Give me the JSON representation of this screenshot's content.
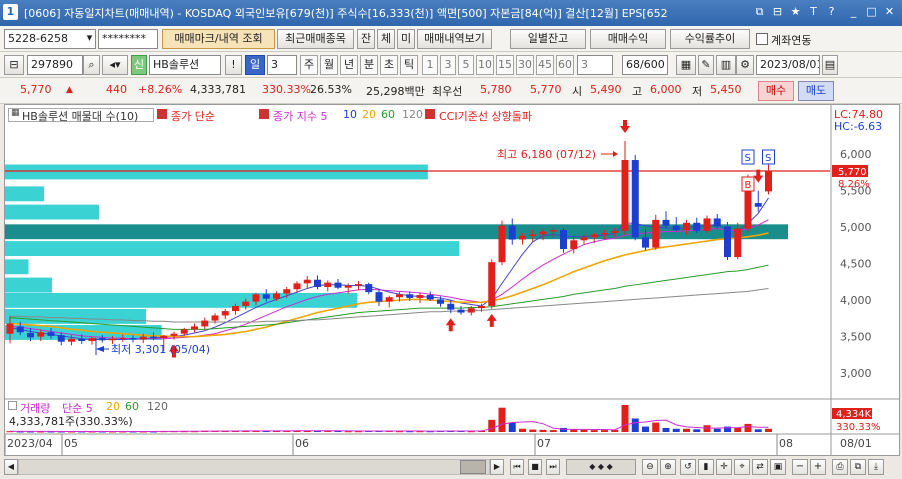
{
  "window": {
    "number": "1",
    "title": "[0606] 자동일지차트(매매내역) - KOSDAQ 외국인보유[679(천)] 주식수[16,333(천)] 액면[500] 자본금[84(억)] 결산[12월] EPS[652",
    "buttons": [
      "⧉",
      "⊟",
      "★",
      "T",
      "?",
      "_",
      "□",
      "✕"
    ]
  },
  "toolbar1": {
    "account": "5228-6258",
    "password": "********",
    "trade_mark_btn": "매매마크/내역 조회",
    "recent_trades_btn": "최근매매종목",
    "tab_balance": "잔",
    "tab_exec": "체",
    "tab_unexec": "미",
    "trade_history_btn": "매매내역보기",
    "daily_balance_btn": "일별잔고",
    "trade_profit_btn": "매매수익",
    "profit_trend_btn": "수익률추이",
    "account_link_label": "계좌연동"
  },
  "toolbar2": {
    "code": "297890",
    "stock_name": "HB솔루션",
    "credit_badge": "신",
    "period_day": "일",
    "period_value": "3",
    "periods": [
      "주",
      "월",
      "년",
      "분",
      "초",
      "틱"
    ],
    "intervals": [
      "1",
      "3",
      "5",
      "10",
      "15",
      "30",
      "45",
      "60"
    ],
    "interval_value": "3",
    "page_count": "68/600",
    "date": "2023/08/01"
  },
  "pricebar": {
    "price": "5,770",
    "change": "440",
    "change_pct": "+8.26%",
    "volume": "4,333,781",
    "volume_ratio": "330.33%",
    "turnover": "26.53%",
    "amount": "25,298백만",
    "priority_sell_label": "최우선",
    "priority_sell": "5,780",
    "priority_buy": "5,770",
    "open_label": "시",
    "open": "5,490",
    "high_label": "고",
    "high": "6,000",
    "low_label": "저",
    "low": "5,450",
    "buy_btn": "매수",
    "sell_btn": "매도"
  },
  "legend": {
    "stock_label": "HB솔루션 매물대 수(10)",
    "price_simple": "종가 단순",
    "price_exp": "종가 지수 5",
    "ma10": "10",
    "ma20": "20",
    "ma60": "60",
    "ma120": "120",
    "cci": "CCI기준선 상향돌파",
    "lc": "LC:74.80",
    "hc": "HC:-6.63"
  },
  "annotations": {
    "high": "최고 6,180 (07/12)",
    "low": "최저 3,301 (05/04)",
    "buy_mark": "B",
    "sell_mark": "S",
    "current_price_tag": "5,770",
    "current_pct_tag": "8.26%"
  },
  "volume_panel": {
    "label": "거래량",
    "simple": "단순 5",
    "ma20": "20",
    "ma60": "60",
    "ma120": "120",
    "value": "4,333,781주(330.33%)",
    "tag_value": "4,334K",
    "tag_pct": "330.33%"
  },
  "colors": {
    "up": "#e0201b",
    "down": "#1d3fd0",
    "profile": "#2fd0d0",
    "profile_max": "#1a8e8c",
    "ma5": "#4444cc",
    "ma10": "#d02ad0",
    "ma20": "#f0a500",
    "ma60": "#2a9a2a",
    "ma120": "#888888"
  },
  "chart_data": {
    "type": "candlestick",
    "ylim": [
      2700,
      6400
    ],
    "y_ticks": [
      "6,000",
      "5,500",
      "5,000",
      "4,500",
      "4,000",
      "3,500",
      "3,000"
    ],
    "x_labels": [
      "2023/04",
      "05",
      "06",
      "07",
      "08"
    ],
    "right_x_labels": [
      "08/01"
    ],
    "candles": [
      [
        3540,
        3780,
        3410,
        3680
      ],
      [
        3640,
        3700,
        3520,
        3560
      ],
      [
        3550,
        3620,
        3440,
        3490
      ],
      [
        3500,
        3600,
        3440,
        3560
      ],
      [
        3560,
        3620,
        3470,
        3510
      ],
      [
        3520,
        3560,
        3380,
        3430
      ],
      [
        3430,
        3520,
        3380,
        3470
      ],
      [
        3470,
        3530,
        3400,
        3440
      ],
      [
        3440,
        3500,
        3390,
        3480
      ],
      [
        3480,
        3520,
        3420,
        3450
      ],
      [
        3450,
        3510,
        3400,
        3470
      ],
      [
        3470,
        3530,
        3430,
        3480
      ],
      [
        3480,
        3520,
        3420,
        3460
      ],
      [
        3460,
        3540,
        3410,
        3500
      ],
      [
        3500,
        3560,
        3450,
        3480
      ],
      [
        3480,
        3520,
        3301,
        3510
      ],
      [
        3510,
        3570,
        3460,
        3540
      ],
      [
        3540,
        3620,
        3510,
        3600
      ],
      [
        3600,
        3680,
        3560,
        3640
      ],
      [
        3640,
        3760,
        3600,
        3720
      ],
      [
        3720,
        3820,
        3680,
        3790
      ],
      [
        3790,
        3880,
        3740,
        3850
      ],
      [
        3850,
        3950,
        3800,
        3920
      ],
      [
        3920,
        4020,
        3870,
        3980
      ],
      [
        3980,
        4100,
        3930,
        4080
      ],
      [
        4080,
        4150,
        3980,
        4020
      ],
      [
        4020,
        4120,
        3990,
        4090
      ],
      [
        4090,
        4180,
        4030,
        4150
      ],
      [
        4150,
        4260,
        4100,
        4230
      ],
      [
        4230,
        4330,
        4160,
        4280
      ],
      [
        4280,
        4340,
        4150,
        4180
      ],
      [
        4180,
        4270,
        4120,
        4240
      ],
      [
        4240,
        4290,
        4150,
        4170
      ],
      [
        4170,
        4230,
        4090,
        4200
      ],
      [
        4200,
        4260,
        4140,
        4220
      ],
      [
        4220,
        4240,
        4080,
        4110
      ],
      [
        4110,
        4150,
        3920,
        3980
      ],
      [
        3980,
        4060,
        3900,
        4040
      ],
      [
        4040,
        4110,
        3980,
        4080
      ],
      [
        4080,
        4120,
        3990,
        4030
      ],
      [
        4030,
        4100,
        3960,
        4070
      ],
      [
        4070,
        4120,
        3990,
        4010
      ],
      [
        4010,
        4050,
        3910,
        3950
      ],
      [
        3950,
        4000,
        3820,
        3870
      ],
      [
        3870,
        3920,
        3800,
        3830
      ],
      [
        3830,
        3920,
        3790,
        3890
      ],
      [
        3890,
        3950,
        3840,
        3920
      ],
      [
        3920,
        4560,
        3880,
        4520
      ],
      [
        4520,
        5090,
        4480,
        5020
      ],
      [
        5020,
        5120,
        4760,
        4830
      ],
      [
        4830,
        4920,
        4760,
        4880
      ],
      [
        4880,
        4960,
        4800,
        4900
      ],
      [
        4900,
        4980,
        4820,
        4940
      ],
      [
        4940,
        4990,
        4860,
        4960
      ],
      [
        4960,
        4990,
        4650,
        4700
      ],
      [
        4700,
        4860,
        4640,
        4820
      ],
      [
        4820,
        4900,
        4760,
        4860
      ],
      [
        4860,
        4920,
        4780,
        4900
      ],
      [
        4900,
        4960,
        4840,
        4920
      ],
      [
        4920,
        4990,
        4870,
        4950
      ],
      [
        4950,
        6180,
        4890,
        5920
      ],
      [
        5920,
        5990,
        4820,
        4860
      ],
      [
        4860,
        4970,
        4680,
        4720
      ],
      [
        4720,
        5170,
        4690,
        5100
      ],
      [
        5100,
        5220,
        4980,
        5020
      ],
      [
        5020,
        5140,
        4940,
        4960
      ],
      [
        4960,
        5100,
        4900,
        5060
      ],
      [
        5060,
        5130,
        4920,
        4950
      ],
      [
        4950,
        5160,
        4920,
        5120
      ],
      [
        5120,
        5180,
        4980,
        5010
      ],
      [
        5010,
        5070,
        4550,
        4590
      ],
      [
        4590,
        5060,
        4560,
        4980
      ],
      [
        4980,
        5720,
        4930,
        5640
      ],
      [
        5330,
        5500,
        5210,
        5280
      ],
      [
        5490,
        6000,
        5450,
        5770
      ]
    ],
    "markers": [
      {
        "type": "up-arrow",
        "candle": 16
      },
      {
        "type": "up-arrow",
        "candle": 43
      },
      {
        "type": "up-arrow",
        "candle": 47
      },
      {
        "type": "down-arrow",
        "candle": 60
      },
      {
        "type": "down-arrow",
        "candle": 73
      }
    ],
    "volume_profile": [
      {
        "price": 5750,
        "weight": 0.54
      },
      {
        "price": 5450,
        "weight": 0.05
      },
      {
        "price": 5200,
        "weight": 0.12
      },
      {
        "price": 4930,
        "weight": 1.0,
        "max": true
      },
      {
        "price": 4700,
        "weight": 0.58
      },
      {
        "price": 4450,
        "weight": 0.03
      },
      {
        "price": 4200,
        "weight": 0.06
      },
      {
        "price": 3990,
        "weight": 0.45
      },
      {
        "price": 3770,
        "weight": 0.18
      },
      {
        "price": 3550,
        "weight": 0.2
      }
    ],
    "ma_lines": {
      "ma5": [
        3620,
        3600,
        3570,
        3550,
        3530,
        3510,
        3490,
        3470,
        3460,
        3460,
        3460,
        3460,
        3470,
        3470,
        3480,
        3490,
        3500,
        3520,
        3550,
        3580,
        3630,
        3690,
        3760,
        3830,
        3900,
        3960,
        4010,
        4060,
        4110,
        4160,
        4200,
        4210,
        4210,
        4200,
        4200,
        4190,
        4150,
        4110,
        4080,
        4060,
        4050,
        4040,
        4030,
        4000,
        3960,
        3940,
        3920,
        4020,
        4230,
        4430,
        4630,
        4800,
        4880,
        4900,
        4880,
        4870,
        4870,
        4880,
        4890,
        4910,
        5060,
        5050,
        5020,
        5000,
        4990,
        4980,
        4990,
        5010,
        5020,
        5030,
        4960,
        4940,
        5050,
        5190,
        5400
      ],
      "ma10": [
        3640,
        3630,
        3610,
        3590,
        3570,
        3550,
        3530,
        3510,
        3500,
        3490,
        3480,
        3480,
        3470,
        3470,
        3470,
        3470,
        3480,
        3490,
        3500,
        3520,
        3540,
        3580,
        3620,
        3670,
        3730,
        3790,
        3850,
        3910,
        3960,
        4010,
        4050,
        4080,
        4100,
        4120,
        4140,
        4150,
        4140,
        4130,
        4120,
        4110,
        4100,
        4080,
        4060,
        4040,
        4010,
        3990,
        3970,
        4000,
        4080,
        4180,
        4290,
        4390,
        4480,
        4560,
        4630,
        4700,
        4760,
        4800,
        4830,
        4850,
        4890,
        4910,
        4920,
        4930,
        4940,
        4940,
        4950,
        4960,
        4970,
        4980,
        4960,
        4950,
        4980,
        5030,
        5100
      ],
      "ma20": [
        3680,
        3670,
        3660,
        3650,
        3640,
        3620,
        3600,
        3590,
        3570,
        3560,
        3550,
        3540,
        3530,
        3520,
        3510,
        3510,
        3500,
        3500,
        3500,
        3510,
        3520,
        3530,
        3550,
        3570,
        3600,
        3630,
        3670,
        3710,
        3750,
        3790,
        3830,
        3860,
        3890,
        3920,
        3950,
        3970,
        3980,
        3990,
        4000,
        4010,
        4010,
        4000,
        3990,
        3980,
        3970,
        3970,
        3970,
        3990,
        4020,
        4060,
        4110,
        4160,
        4210,
        4270,
        4330,
        4390,
        4440,
        4490,
        4540,
        4580,
        4620,
        4650,
        4680,
        4710,
        4730,
        4750,
        4770,
        4790,
        4810,
        4830,
        4840,
        4850,
        4870,
        4890,
        4920
      ],
      "ma60": [
        3760,
        3750,
        3740,
        3730,
        3720,
        3710,
        3700,
        3690,
        3680,
        3670,
        3660,
        3650,
        3640,
        3630,
        3620,
        3610,
        3600,
        3600,
        3600,
        3600,
        3610,
        3620,
        3630,
        3640,
        3650,
        3660,
        3670,
        3690,
        3710,
        3730,
        3750,
        3770,
        3790,
        3810,
        3830,
        3840,
        3850,
        3860,
        3870,
        3880,
        3890,
        3890,
        3890,
        3890,
        3890,
        3900,
        3900,
        3910,
        3930,
        3950,
        3970,
        3990,
        4010,
        4030,
        4050,
        4080,
        4100,
        4120,
        4140,
        4160,
        4190,
        4210,
        4230,
        4250,
        4270,
        4290,
        4310,
        4330,
        4350,
        4370,
        4390,
        4400,
        4420,
        4450,
        4480
      ],
      "ma120": [
        3780,
        3780,
        3770,
        3770,
        3760,
        3760,
        3750,
        3750,
        3740,
        3740,
        3730,
        3730,
        3720,
        3720,
        3710,
        3710,
        3700,
        3700,
        3700,
        3700,
        3700,
        3700,
        3700,
        3700,
        3700,
        3710,
        3710,
        3720,
        3720,
        3730,
        3730,
        3740,
        3750,
        3760,
        3770,
        3780,
        3790,
        3800,
        3810,
        3820,
        3830,
        3840,
        3840,
        3850,
        3850,
        3860,
        3860,
        3870,
        3880,
        3890,
        3900,
        3910,
        3920,
        3930,
        3940,
        3950,
        3960,
        3970,
        3980,
        3990,
        4000,
        4010,
        4020,
        4030,
        4040,
        4050,
        4060,
        4070,
        4080,
        4090,
        4100,
        4110,
        4120,
        4140,
        4160
      ]
    },
    "volume": [
      0.03,
      0.02,
      0.02,
      0.02,
      0.02,
      0.02,
      0.02,
      0.02,
      0.02,
      0.02,
      0.02,
      0.02,
      0.02,
      0.02,
      0.02,
      0.03,
      0.03,
      0.03,
      0.03,
      0.04,
      0.04,
      0.04,
      0.04,
      0.04,
      0.05,
      0.04,
      0.04,
      0.04,
      0.05,
      0.05,
      0.04,
      0.04,
      0.04,
      0.03,
      0.03,
      0.04,
      0.05,
      0.04,
      0.03,
      0.03,
      0.03,
      0.03,
      0.04,
      0.05,
      0.04,
      0.03,
      0.04,
      0.45,
      0.9,
      0.35,
      0.12,
      0.09,
      0.08,
      0.07,
      0.15,
      0.1,
      0.08,
      0.07,
      0.07,
      0.08,
      1.0,
      0.5,
      0.2,
      0.35,
      0.15,
      0.12,
      0.12,
      0.1,
      0.25,
      0.12,
      0.2,
      0.15,
      0.3,
      0.1,
      0.12
    ]
  },
  "scroll": {
    "zoom_plus": "+",
    "zoom_minus": "−"
  }
}
